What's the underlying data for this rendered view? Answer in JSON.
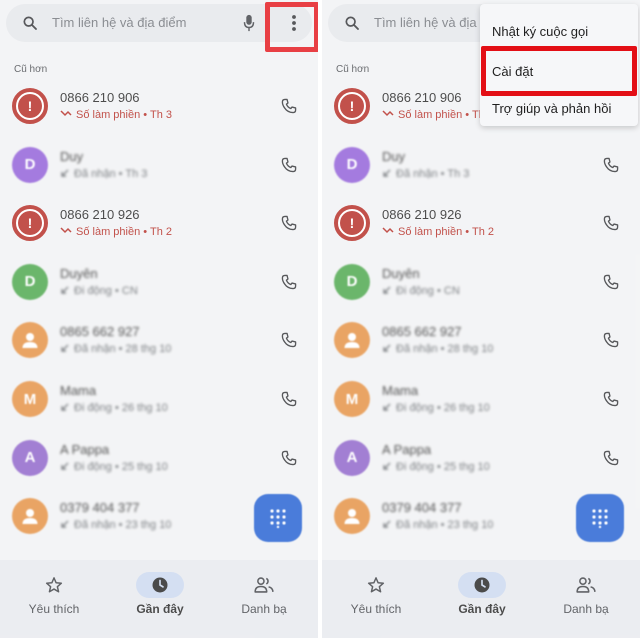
{
  "search": {
    "placeholder": "Tìm liên hệ và địa điểm"
  },
  "section_label": "Cũ hơn",
  "calls": [
    {
      "name": "0866 210 906",
      "detail": "Số làm phiền • Th 3",
      "type": "spam"
    },
    {
      "name": "Duy",
      "detail": "Đã nhận • Th 3",
      "type": "contact",
      "avatar_letter": "D",
      "color": "#8e5ad8"
    },
    {
      "name": "0866 210 926",
      "detail": "Số làm phiền • Th 2",
      "type": "spam"
    },
    {
      "name": "Duyên",
      "detail": "Đi động • CN",
      "type": "contact",
      "avatar_letter": "D",
      "color": "#47a447"
    },
    {
      "name": "0865 662 927",
      "detail": "Đã nhận • 28 thg 10",
      "type": "contact",
      "avatar_letter": "",
      "color": "#e48e3e"
    },
    {
      "name": "Mama",
      "detail": "Đi động • 26 thg 10",
      "type": "contact",
      "avatar_letter": "M",
      "color": "#e48e3e"
    },
    {
      "name": "A Pappa",
      "detail": "Đi động • 25 thg 10",
      "type": "contact",
      "avatar_letter": "A",
      "color": "#8b5fc9"
    },
    {
      "name": "0379 404 377",
      "detail": "Đã nhận • 23 thg 10",
      "type": "contact",
      "avatar_letter": "",
      "color": "#e48e3e"
    }
  ],
  "nav": {
    "favorites": "Yêu thích",
    "recents": "Gần đây",
    "contacts": "Danh bạ"
  },
  "menu": {
    "call_history": "Nhật ký cuộc gọi",
    "settings": "Cài đặt",
    "help": "Trợ giúp và phản hồi"
  },
  "colors": {
    "spam": "#b3261e",
    "highlight": "#e30f16",
    "fab": "#1d5cd1",
    "active_nav": "#cad8ef"
  }
}
